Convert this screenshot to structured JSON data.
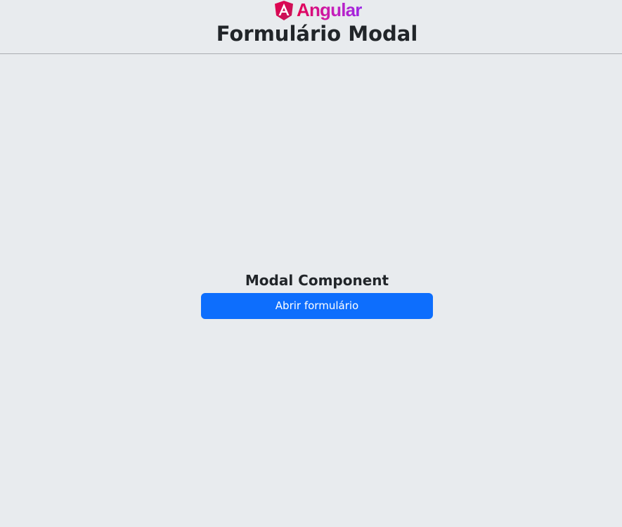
{
  "header": {
    "brand_text": "Angular",
    "brand_icon": "angular-logo-icon",
    "title": "Formulário Modal"
  },
  "main": {
    "component_title": "Modal Component",
    "open_button_label": "Abrir formulário"
  },
  "colors": {
    "background": "#e8ebee",
    "primary_button": "#0d6efd",
    "text": "#212529",
    "brand_gradient_start": "#e4004f",
    "brand_gradient_end": "#9b27e6"
  }
}
